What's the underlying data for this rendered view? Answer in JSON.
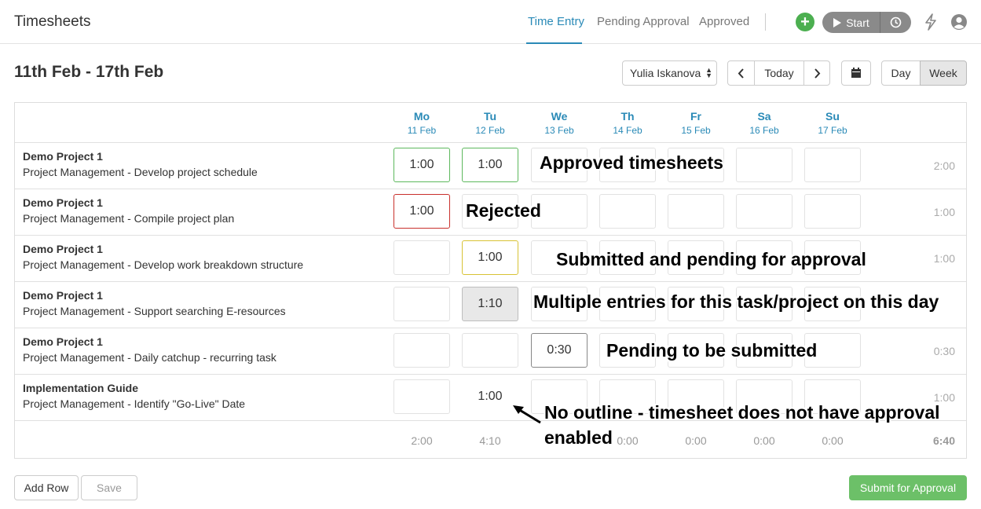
{
  "header": {
    "title": "Timesheets",
    "tabs": [
      {
        "label": "Time Entry",
        "active": true
      },
      {
        "label": "Pending Approval",
        "active": false
      },
      {
        "label": "Approved",
        "active": false
      }
    ],
    "start_label": "Start",
    "icons": [
      "plus-icon",
      "play-icon",
      "clock-icon",
      "bolt-icon",
      "user-icon"
    ]
  },
  "toolbar": {
    "week_title": "11th Feb - 17th Feb",
    "user_select": "Yulia Iskanova",
    "today_label": "Today",
    "day_label": "Day",
    "week_label": "Week",
    "active_view": "Week"
  },
  "days": [
    {
      "name": "Mo",
      "date": "11 Feb"
    },
    {
      "name": "Tu",
      "date": "12 Feb"
    },
    {
      "name": "We",
      "date": "13 Feb"
    },
    {
      "name": "Th",
      "date": "14 Feb"
    },
    {
      "name": "Fr",
      "date": "15 Feb"
    },
    {
      "name": "Sa",
      "date": "16 Feb"
    },
    {
      "name": "Su",
      "date": "17 Feb"
    }
  ],
  "rows": [
    {
      "project": "Demo Project 1",
      "task": "Project Management - Develop project schedule",
      "total": "2:00",
      "cells": [
        {
          "value": "1:00",
          "status": "approved"
        },
        {
          "value": "1:00",
          "status": "approved"
        },
        {
          "value": "",
          "status": ""
        },
        {
          "value": "",
          "status": ""
        },
        {
          "value": "",
          "status": ""
        },
        {
          "value": "",
          "status": ""
        },
        {
          "value": "",
          "status": ""
        }
      ]
    },
    {
      "project": "Demo Project 1",
      "task": "Project Management - Compile project plan",
      "total": "1:00",
      "cells": [
        {
          "value": "1:00",
          "status": "rejected"
        },
        {
          "value": "",
          "status": ""
        },
        {
          "value": "",
          "status": ""
        },
        {
          "value": "",
          "status": ""
        },
        {
          "value": "",
          "status": ""
        },
        {
          "value": "",
          "status": ""
        },
        {
          "value": "",
          "status": ""
        }
      ]
    },
    {
      "project": "Demo Project 1",
      "task": "Project Management - Develop work breakdown structure",
      "total": "1:00",
      "cells": [
        {
          "value": "",
          "status": ""
        },
        {
          "value": "1:00",
          "status": "submitted"
        },
        {
          "value": "",
          "status": ""
        },
        {
          "value": "",
          "status": ""
        },
        {
          "value": "",
          "status": ""
        },
        {
          "value": "",
          "status": ""
        },
        {
          "value": "",
          "status": ""
        }
      ]
    },
    {
      "project": "Demo Project 1",
      "task": "Project Management - Support searching E-resources",
      "total": "",
      "cells": [
        {
          "value": "",
          "status": ""
        },
        {
          "value": "1:10",
          "status": "multiple"
        },
        {
          "value": "",
          "status": ""
        },
        {
          "value": "",
          "status": ""
        },
        {
          "value": "",
          "status": ""
        },
        {
          "value": "",
          "status": ""
        },
        {
          "value": "",
          "status": ""
        }
      ]
    },
    {
      "project": "Demo Project 1",
      "task": "Project Management - Daily catchup - recurring task",
      "total": "0:30",
      "cells": [
        {
          "value": "",
          "status": ""
        },
        {
          "value": "",
          "status": ""
        },
        {
          "value": "0:30",
          "status": "pending"
        },
        {
          "value": "",
          "status": ""
        },
        {
          "value": "",
          "status": ""
        },
        {
          "value": "",
          "status": ""
        },
        {
          "value": "",
          "status": ""
        }
      ]
    },
    {
      "project": "Implementation Guide",
      "task": "Project Management - Identify \"Go-Live\" Date",
      "total": "1:00",
      "cells": [
        {
          "value": "",
          "status": ""
        },
        {
          "value": "1:00",
          "status": "noapproval"
        },
        {
          "value": "",
          "status": ""
        },
        {
          "value": "",
          "status": ""
        },
        {
          "value": "",
          "status": ""
        },
        {
          "value": "",
          "status": ""
        },
        {
          "value": "",
          "status": ""
        }
      ]
    }
  ],
  "column_totals": [
    "2:00",
    "4:10",
    "",
    "0:00",
    "0:00",
    "0:00",
    "0:00"
  ],
  "grand_total": "6:40",
  "annotations": {
    "approved": "Approved timesheets",
    "rejected": "Rejected",
    "submitted": "Submitted and pending for approval",
    "multiple": "Multiple entries for this task/project on this day",
    "pending": "Pending to be submitted",
    "noapproval_line1": "No outline - timesheet does not have approval",
    "noapproval_line2": "enabled"
  },
  "footer": {
    "add_row": "Add Row",
    "save": "Save",
    "submit": "Submit for Approval"
  },
  "colors": {
    "accent": "#2a8ab7",
    "approved": "#5cb85c",
    "rejected": "#c9302c",
    "submitted": "#d8c234",
    "submit_button": "#6cc068",
    "add_button": "#4caf50"
  }
}
